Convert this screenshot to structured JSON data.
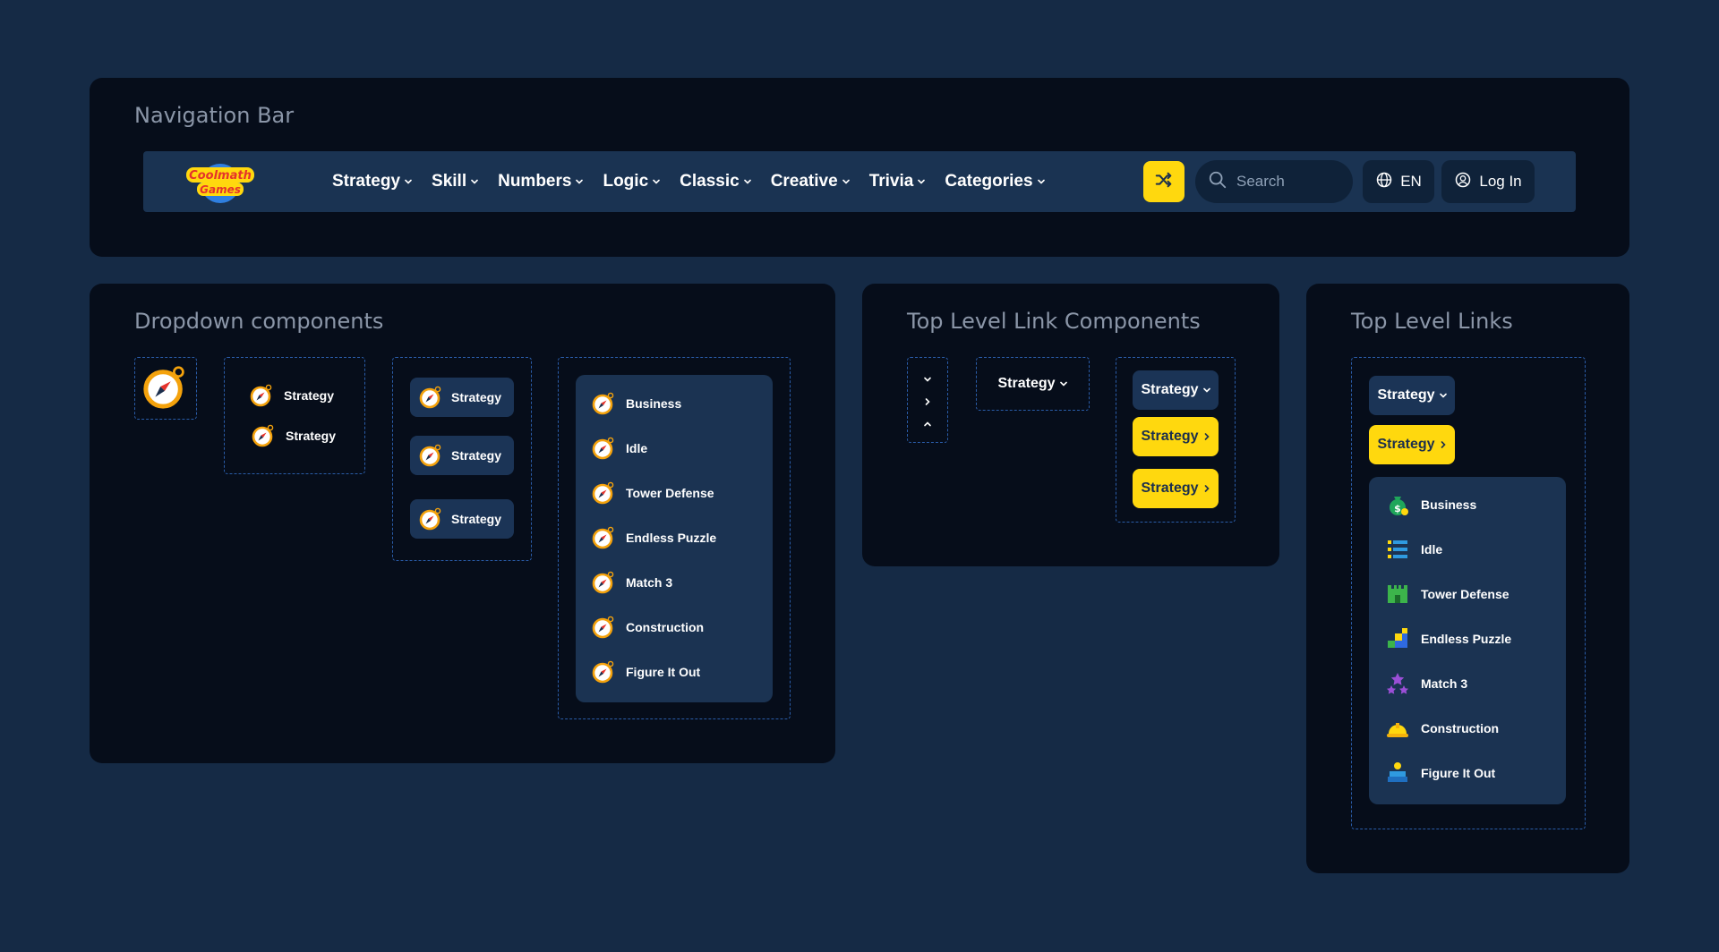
{
  "panels": {
    "nav_title": "Navigation Bar",
    "dropdown_title": "Dropdown components",
    "toplink_components_title": "Top Level Link Components",
    "toplinks_title": "Top Level Links"
  },
  "navbar": {
    "logo_text": "Coolmath Games",
    "items": [
      {
        "label": "Strategy"
      },
      {
        "label": "Skill"
      },
      {
        "label": "Numbers"
      },
      {
        "label": "Logic"
      },
      {
        "label": "Classic"
      },
      {
        "label": "Creative"
      },
      {
        "label": "Trivia"
      },
      {
        "label": "Categories"
      }
    ],
    "search_placeholder": "Search",
    "lang_label": "EN",
    "login_label": "Log In"
  },
  "dropdown": {
    "plain_items": [
      "Strategy",
      "Strategy"
    ],
    "button_items": [
      "Strategy",
      "Strategy",
      "Strategy"
    ],
    "menu_items": [
      "Business",
      "Idle",
      "Tower Defense",
      "Endless Puzzle",
      "Match 3",
      "Construction",
      "Figure It Out"
    ]
  },
  "toplink_components": {
    "plain_label": "Strategy",
    "dark_label": "Strategy",
    "yellow_labels": [
      "Strategy",
      "Strategy"
    ]
  },
  "toplinks": {
    "dark_label": "Strategy",
    "yellow_label": "Strategy",
    "menu_items": [
      {
        "label": "Business",
        "icon": "money-bag-icon"
      },
      {
        "label": "Idle",
        "icon": "list-icon"
      },
      {
        "label": "Tower Defense",
        "icon": "castle-icon"
      },
      {
        "label": "Endless Puzzle",
        "icon": "blocks-icon"
      },
      {
        "label": "Match 3",
        "icon": "stars-icon"
      },
      {
        "label": "Construction",
        "icon": "hardhat-icon"
      },
      {
        "label": "Figure It Out",
        "icon": "person-box-icon"
      }
    ]
  },
  "colors": {
    "background": "#152a45",
    "panel": "#060d1a",
    "navbar": "#1a3352",
    "accent_yellow": "#ffd80e",
    "dashed": "#2a5ca8"
  }
}
